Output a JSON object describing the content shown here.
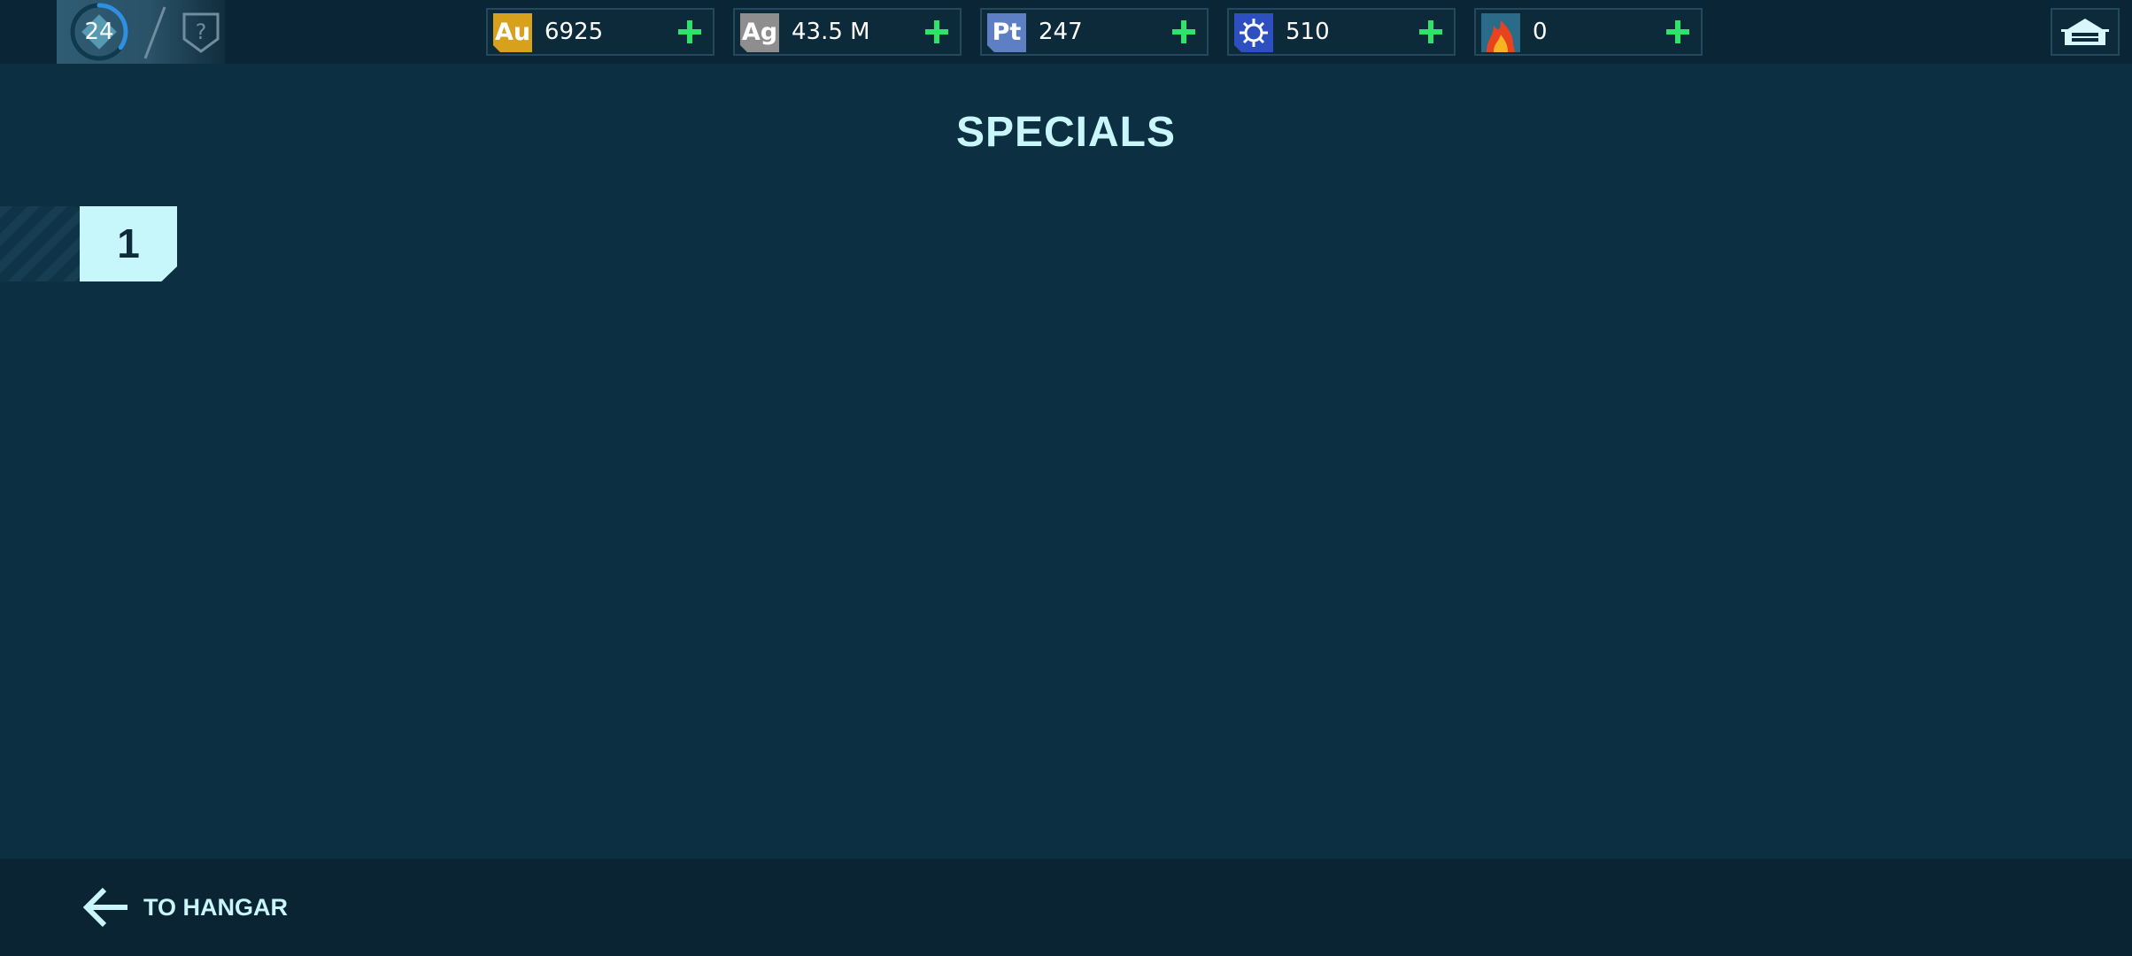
{
  "player": {
    "level": "24",
    "level_progress": 0.35
  },
  "resources": [
    {
      "id": "gold",
      "symbol": "Au",
      "value": "6925",
      "color": "#d8a11c"
    },
    {
      "id": "silver",
      "symbol": "Ag",
      "value": "43.5 M",
      "color": "#8e8e8e"
    },
    {
      "id": "platinum",
      "symbol": "Pt",
      "value": "247",
      "color": "#5f7fc4"
    },
    {
      "id": "keys",
      "symbol": "",
      "value": "510",
      "color": "#2e4fbf"
    },
    {
      "id": "fire",
      "symbol": "",
      "value": "0",
      "color": "#2b6b8a"
    }
  ],
  "header": {
    "title": "SPECIALS"
  },
  "tabs": [
    {
      "label": "1",
      "active": true
    }
  ],
  "footer": {
    "back_label": "TO HANGAR"
  },
  "colors": {
    "background": "#0c2f42",
    "accent": "#c9f6fb",
    "plus": "#2fe36a"
  }
}
